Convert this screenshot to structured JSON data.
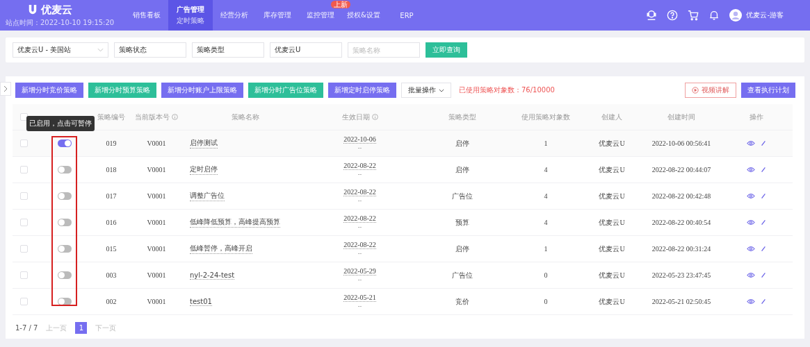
{
  "header": {
    "logo": "优麦云",
    "site_time": "站点时间：2022-10-10 19:15:20",
    "nav": [
      {
        "label": "销售看板",
        "selected": false
      },
      {
        "label": "广告管理",
        "sublabel": "定时策略",
        "selected": true
      },
      {
        "label": "经营分析",
        "selected": false
      },
      {
        "label": "库存管理",
        "selected": false
      },
      {
        "label": "监控管理",
        "badge": "上新",
        "selected": false
      },
      {
        "label": "授权&设置",
        "selected": false
      },
      {
        "label": "ERP",
        "selected": false
      }
    ],
    "user": "优麦云-游客"
  },
  "filters": {
    "site_select": "优麦云U - 美国站",
    "fields": [
      {
        "value": "策略状态"
      },
      {
        "value": "策略类型"
      },
      {
        "value": "优麦云U"
      },
      {
        "placeholder": "策略名称"
      }
    ],
    "query_button": "立即查询"
  },
  "toolbar": {
    "buttons": [
      {
        "label": "新增分时竞价策略",
        "kind": "primary"
      },
      {
        "label": "新增分时预算策略",
        "kind": "success"
      },
      {
        "label": "新增分时账户上限策略",
        "kind": "primary"
      },
      {
        "label": "新增分时广告位策略",
        "kind": "success"
      },
      {
        "label": "新增定时启停策略",
        "kind": "primary"
      }
    ],
    "batch_dropdown": "批量操作",
    "usage": "已使用策略对象数：76/10000",
    "video_button": "视频讲解",
    "plan_button": "查看执行计划"
  },
  "table": {
    "select_all": {
      "checked": false
    },
    "status_column_highlighted": true,
    "tooltip": "已启用，点击可暂停",
    "columns": [
      {
        "label": "策略编号"
      },
      {
        "label": "当前版本号",
        "info": true
      },
      {
        "label": "策略名称"
      },
      {
        "label": "生效日期",
        "info": true
      },
      {
        "label": "策略类型"
      },
      {
        "label": "使用策略对象数"
      },
      {
        "label": "创建人"
      },
      {
        "label": "创建时间"
      },
      {
        "label": "操作"
      }
    ],
    "rows": [
      {
        "checked": false,
        "on": true,
        "id": "019",
        "version": "V0001",
        "name": "启停测试",
        "date": "2022-10-06",
        "date_end": "--",
        "type": "启停",
        "count": "1",
        "creator": "优麦云U",
        "created": "2022-10-06 00:56:41"
      },
      {
        "checked": false,
        "on": false,
        "id": "018",
        "version": "V0001",
        "name": "定时启停",
        "date": "2022-08-22",
        "date_end": "--",
        "type": "启停",
        "count": "4",
        "creator": "优麦云U",
        "created": "2022-08-22 00:44:07"
      },
      {
        "checked": false,
        "on": false,
        "id": "017",
        "version": "V0001",
        "name": "调整广告位",
        "date": "2022-08-22",
        "date_end": "--",
        "type": "广告位",
        "count": "4",
        "creator": "优麦云U",
        "created": "2022-08-22 00:42:48"
      },
      {
        "checked": false,
        "on": false,
        "id": "016",
        "version": "V0001",
        "name": "低峰降低预算，高峰提高预算",
        "date": "2022-08-22",
        "date_end": "--",
        "type": "预算",
        "count": "4",
        "creator": "优麦云U",
        "created": "2022-08-22 00:40:54"
      },
      {
        "checked": false,
        "on": false,
        "id": "015",
        "version": "V0001",
        "name": "低峰暂停，高峰开启",
        "date": "2022-08-22",
        "date_end": "--",
        "type": "启停",
        "count": "1",
        "creator": "优麦云U",
        "created": "2022-08-22 00:31:24"
      },
      {
        "checked": false,
        "on": false,
        "id": "003",
        "version": "V0001",
        "name": "nyl-2-24-test",
        "date": "2022-05-29",
        "date_end": "--",
        "type": "广告位",
        "count": "0",
        "creator": "优麦云U",
        "created": "2022-05-23 23:47:45"
      },
      {
        "checked": false,
        "on": false,
        "id": "002",
        "version": "V0001",
        "name": "test01",
        "date": "2022-05-21",
        "date_end": "--",
        "type": "竞价",
        "count": "0",
        "creator": "优麦云U",
        "created": "2022-05-21 02:50:45"
      }
    ]
  },
  "pagination": {
    "range": "1-7 / 7",
    "prev": "上一页",
    "pages": [
      {
        "label": "1",
        "selected": true
      }
    ],
    "next": "下一页"
  }
}
